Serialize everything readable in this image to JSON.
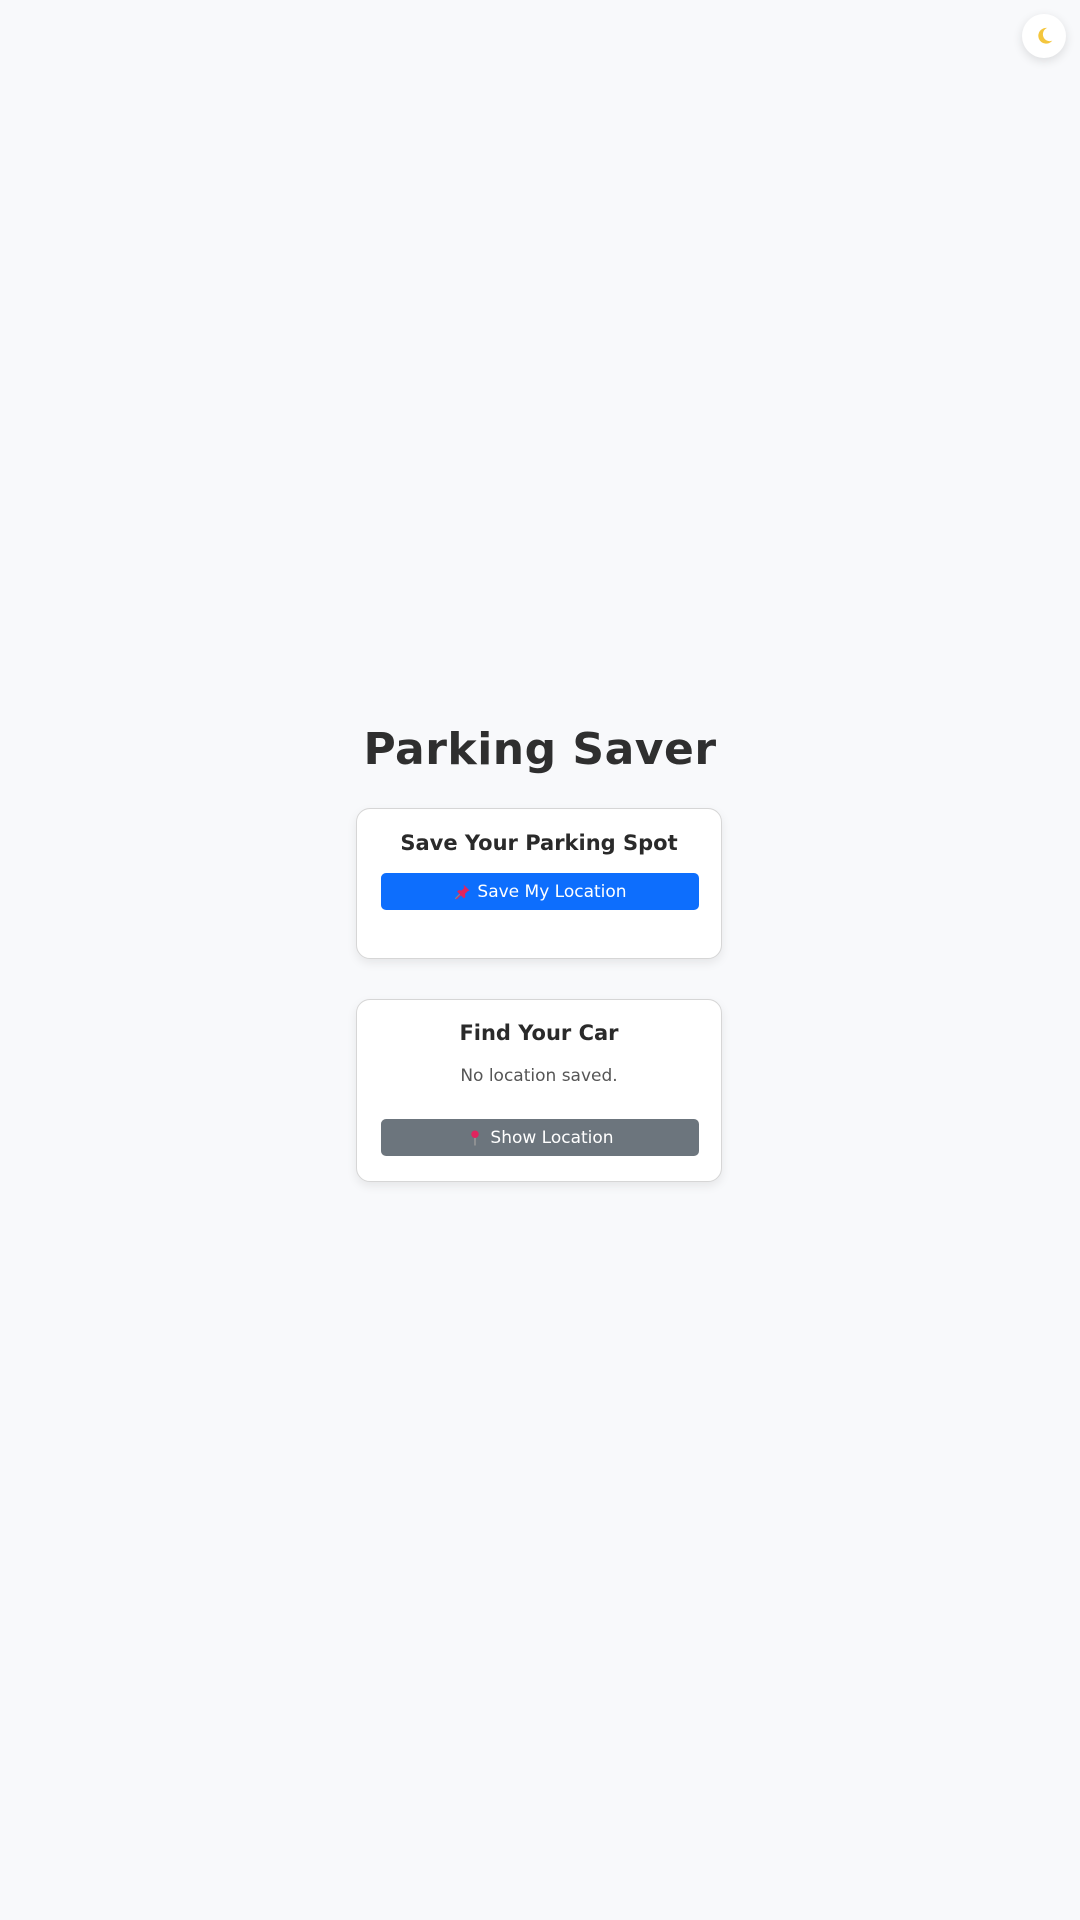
{
  "header": {
    "title": "Parking Saver",
    "theme_toggle_icon": "moon-icon"
  },
  "save_card": {
    "title": "Save Your Parking Spot",
    "button_label": "Save My Location",
    "button_icon": "pushpin-icon"
  },
  "find_card": {
    "title": "Find Your Car",
    "status": "No location saved.",
    "button_label": "Show Location",
    "button_icon": "round-pin-icon"
  },
  "colors": {
    "background": "#f8f9fb",
    "primary": "#0d6efd",
    "secondary": "#6c757d",
    "moon": "#f4c63d"
  }
}
